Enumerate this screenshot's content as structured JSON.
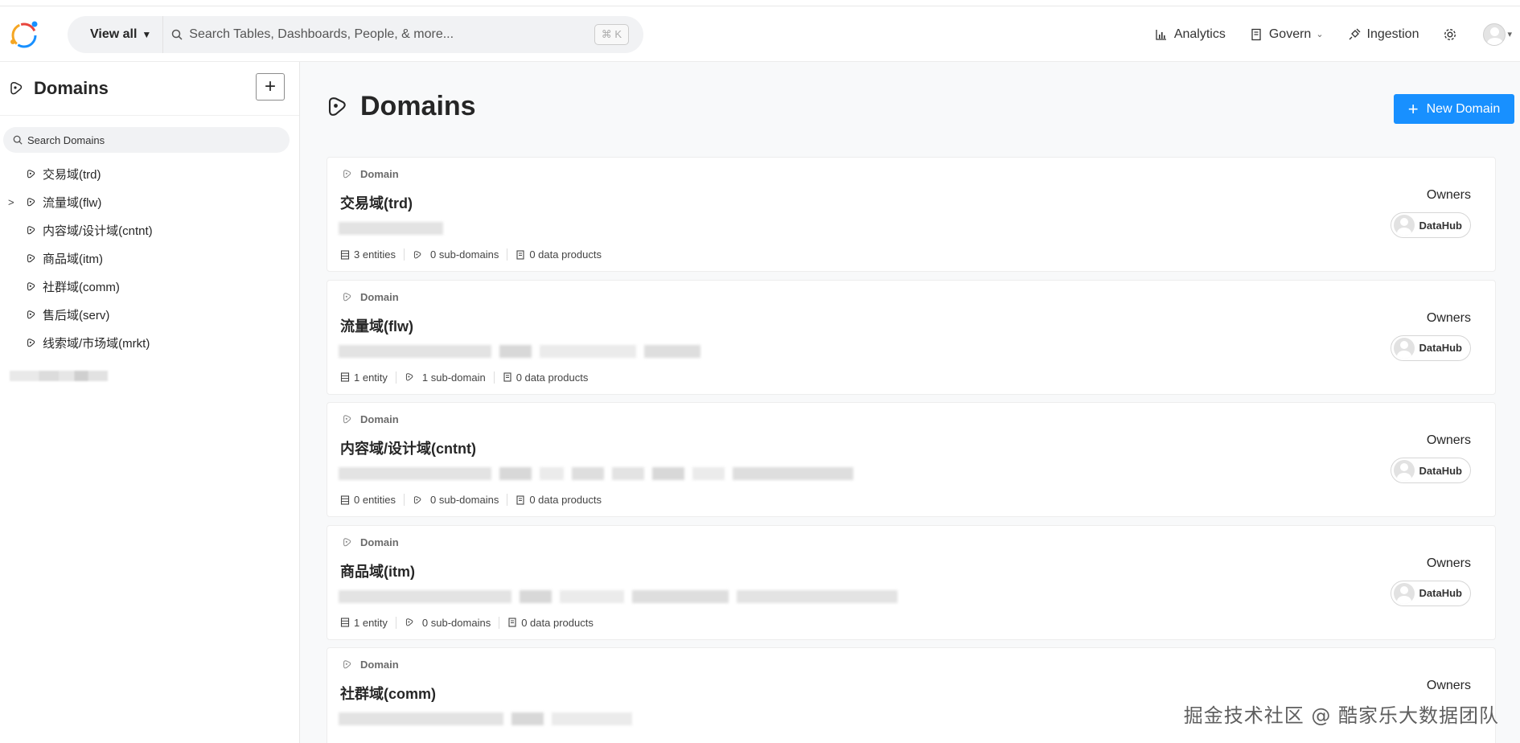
{
  "header": {
    "view_all": "View all",
    "search_placeholder": "Search Tables, Dashboards, People, & more...",
    "shortcut": "⌘ K",
    "nav": {
      "analytics": "Analytics",
      "govern": "Govern",
      "ingestion": "Ingestion"
    }
  },
  "sidebar": {
    "title": "Domains",
    "add_label": "+",
    "search_placeholder": "Search Domains",
    "items": [
      {
        "label": "交易域(trd)",
        "expandable": false
      },
      {
        "label": "流量域(flw)",
        "expandable": true
      },
      {
        "label": "内容域/设计域(cntnt)",
        "expandable": false
      },
      {
        "label": "商品域(itm)",
        "expandable": false
      },
      {
        "label": "社群域(comm)",
        "expandable": false
      },
      {
        "label": "售后域(serv)",
        "expandable": false
      },
      {
        "label": "线索域/市场域(mrkt)",
        "expandable": false
      }
    ]
  },
  "main": {
    "title": "Domains",
    "new_button": "New Domain",
    "domains": [
      {
        "type": "Domain",
        "name": "交易域(trd)",
        "entities": "3 entities",
        "subdomains": "0 sub-domains",
        "products": "0 data products",
        "owners_label": "Owners",
        "owner": "DataHub"
      },
      {
        "type": "Domain",
        "name": "流量域(flw)",
        "entities": "1 entity",
        "subdomains": "1 sub-domain",
        "products": "0 data products",
        "owners_label": "Owners",
        "owner": "DataHub"
      },
      {
        "type": "Domain",
        "name": "内容域/设计域(cntnt)",
        "entities": "0 entities",
        "subdomains": "0 sub-domains",
        "products": "0 data products",
        "owners_label": "Owners",
        "owner": "DataHub"
      },
      {
        "type": "Domain",
        "name": "商品域(itm)",
        "entities": "1 entity",
        "subdomains": "0 sub-domains",
        "products": "0 data products",
        "owners_label": "Owners",
        "owner": "DataHub"
      },
      {
        "type": "Domain",
        "name": "社群域(comm)",
        "entities": "",
        "subdomains": "",
        "products": "",
        "owners_label": "Owners",
        "owner": ""
      }
    ]
  },
  "watermark": "掘金技术社区 @ 酷家乐大数据团队",
  "colors": {
    "primary": "#1890ff",
    "background": "#f8f9fa"
  }
}
